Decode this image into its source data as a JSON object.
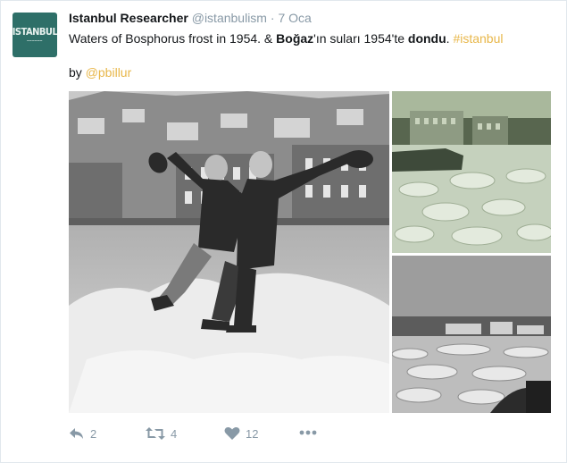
{
  "tweet": {
    "author_name": "Istanbul Researcher",
    "author_handle": "@istanbulism",
    "separator": "·",
    "timestamp": "7 Oca",
    "avatar_text": "ISTANBUL",
    "text_part1": "Waters of Bosphorus frost in 1954. & ",
    "text_bold1": "Boğaz",
    "text_part2": "'ın suları 1954'te ",
    "text_bold2": "dondu",
    "text_part3": ". ",
    "hashtag": "#istanbul",
    "by_prefix": "by ",
    "mention": "@pbillur"
  },
  "media": {
    "photos": [
      {
        "subject": "two men sitting on ice block in Bosphorus"
      },
      {
        "subject": "frozen Bosphorus with building and boat"
      },
      {
        "subject": "ice floes on Bosphorus with shoreline"
      }
    ]
  },
  "actions": {
    "reply_count": "2",
    "retweet_count": "4",
    "like_count": "12",
    "reply_icon": "reply-icon",
    "retweet_icon": "retweet-icon",
    "like_icon": "heart-icon",
    "more_icon": "more-icon"
  },
  "colors": {
    "link": "#e8b74a",
    "muted": "#8899a6",
    "avatar_bg": "#2e6f68"
  }
}
